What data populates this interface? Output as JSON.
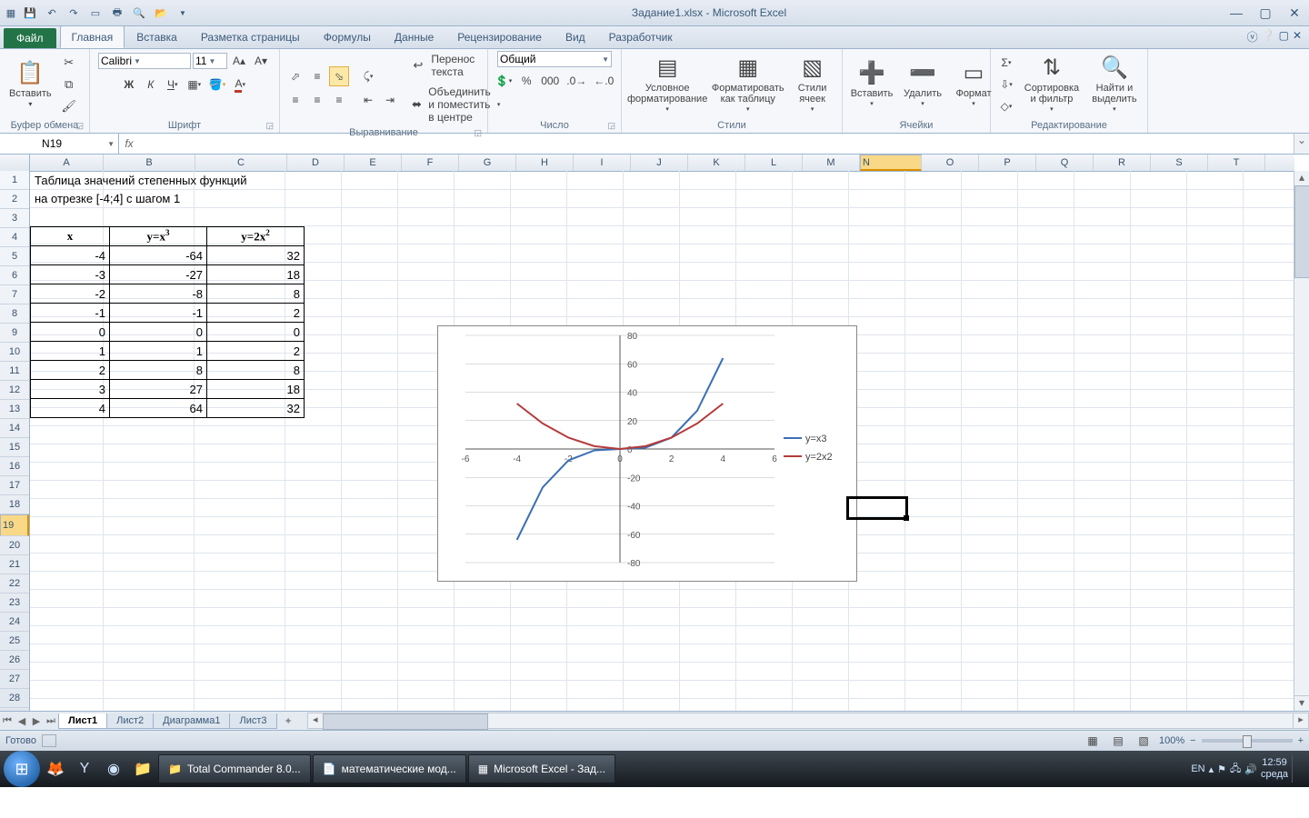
{
  "title": {
    "doc": "Задание1.xlsx",
    "app": "Microsoft Excel"
  },
  "qat": [
    "excel-icon",
    "save-icon",
    "undo-icon",
    "redo-icon",
    "new-icon",
    "quickprint-icon",
    "preview-icon",
    "open-icon",
    "down-icon"
  ],
  "tabs": {
    "file": "Файл",
    "items": [
      "Главная",
      "Вставка",
      "Разметка страницы",
      "Формулы",
      "Данные",
      "Рецензирование",
      "Вид",
      "Разработчик"
    ],
    "active": 0
  },
  "ribbon": {
    "clipboard": {
      "paste": "Вставить",
      "label": "Буфер обмена"
    },
    "font": {
      "name": "Calibri",
      "size": "11",
      "label": "Шрифт"
    },
    "align": {
      "wrap": "Перенос текста",
      "merge": "Объединить и поместить в центре",
      "label": "Выравнивание"
    },
    "number": {
      "format": "Общий",
      "label": "Число"
    },
    "styles": {
      "cond": "Условное форматирование",
      "table": "Форматировать как таблицу",
      "cell": "Стили ячеек",
      "label": "Стили"
    },
    "cells": {
      "insert": "Вставить",
      "delete": "Удалить",
      "format": "Формат",
      "label": "Ячейки"
    },
    "editing": {
      "sort": "Сортировка и фильтр",
      "find": "Найти и выделить",
      "label": "Редактирование"
    }
  },
  "namebox": "N19",
  "columns": [
    "A",
    "B",
    "C",
    "D",
    "E",
    "F",
    "G",
    "H",
    "I",
    "J",
    "K",
    "L",
    "M",
    "N",
    "O",
    "P",
    "Q",
    "R",
    "S",
    "T"
  ],
  "col_widths": {
    "A": 80,
    "B": 100,
    "C": 100,
    "default": 62
  },
  "rows": 30,
  "selected": {
    "col": "N",
    "row": 19
  },
  "sheet_text": {
    "A1": "Таблица значений степенных функций",
    "A2": "          на отрезке [-4;4] с шагом 1"
  },
  "table": {
    "headers": [
      "x",
      "y=x³",
      "y=2x²"
    ],
    "rows": [
      [
        "-4",
        "-64",
        "32"
      ],
      [
        "-3",
        "-27",
        "18"
      ],
      [
        "-2",
        "-8",
        "8"
      ],
      [
        "-1",
        "-1",
        "2"
      ],
      [
        "0",
        "0",
        "0"
      ],
      [
        "1",
        "1",
        "2"
      ],
      [
        "2",
        "8",
        "8"
      ],
      [
        "3",
        "27",
        "18"
      ],
      [
        "4",
        "64",
        "32"
      ]
    ]
  },
  "sheets": {
    "items": [
      "Лист1",
      "Лист2",
      "Диаграмма1",
      "Лист3"
    ],
    "active": 0
  },
  "status": {
    "ready": "Готово",
    "zoom": "100%"
  },
  "taskbar": {
    "items": [
      "Total Commander 8.0...",
      "математические мод...",
      "Microsoft Excel - Зад..."
    ],
    "time": "12:59",
    "day": "среда",
    "lang": "EN"
  },
  "chart_data": {
    "type": "line",
    "x": [
      -4,
      -3,
      -2,
      -1,
      0,
      1,
      2,
      3,
      4
    ],
    "series": [
      {
        "name": "y=x3",
        "values": [
          -64,
          -27,
          -8,
          -1,
          0,
          1,
          8,
          27,
          64
        ],
        "color": "#3b6fb5"
      },
      {
        "name": "y=2x2",
        "values": [
          32,
          18,
          8,
          2,
          0,
          2,
          8,
          18,
          32
        ],
        "color": "#b53b3b"
      }
    ],
    "xlim": [
      -6,
      6
    ],
    "ylim": [
      -80,
      80
    ],
    "xticks": [
      -6,
      -4,
      -2,
      0,
      2,
      4,
      6
    ],
    "yticks": [
      -80,
      -60,
      -40,
      -20,
      0,
      20,
      40,
      60,
      80
    ]
  }
}
